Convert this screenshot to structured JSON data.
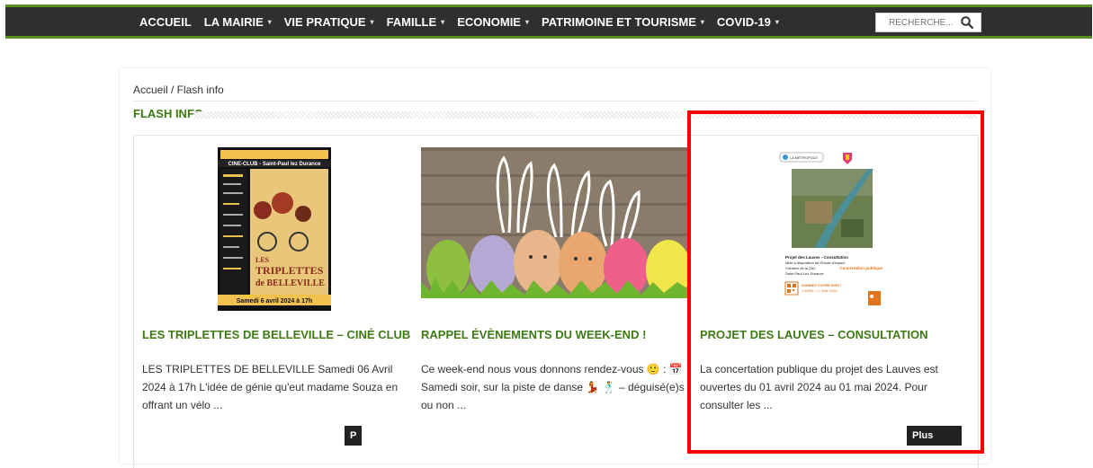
{
  "nav": {
    "items": [
      {
        "label": "ACCUEIL",
        "has_caret": false
      },
      {
        "label": "LA MAIRIE",
        "has_caret": true
      },
      {
        "label": "VIE PRATIQUE",
        "has_caret": true
      },
      {
        "label": "FAMILLE",
        "has_caret": true
      },
      {
        "label": "ECONOMIE",
        "has_caret": true
      },
      {
        "label": "PATRIMOINE ET TOURISME",
        "has_caret": true
      },
      {
        "label": "COVID-19",
        "has_caret": true
      }
    ],
    "caret_glyph": "▾"
  },
  "search": {
    "placeholder": "RECHERCHE..."
  },
  "breadcrumb": "Accueil / Flash info",
  "section_title": "FLASH INFO",
  "posts": [
    {
      "title": "LES TRIPLETTES DE BELLEVILLE – CINÉ CLUB",
      "excerpt": "LES TRIPLETTES DE BELLEVILLE Samedi 06 Avril 2024 à 17h L'idée de génie qu'eut madame Souza en offrant un vélo ...",
      "more": "P",
      "poster": {
        "header": "CINE-CLUB - Saint-Paul lez Durance",
        "line1": "LES",
        "line2": "TRIPLETTES",
        "line3": "de BELLEVILLE",
        "date": "Samedi 6 avril 2024 à 17h"
      }
    },
    {
      "title": "RAPPEL ÉVÈNEMENTS DU WEEK-END !",
      "excerpt": "Ce week-end nous vous donnons rendez-vous 🙂 : 📅 Samedi soir, sur la piste de danse 💃 🕺 – déguisé(e)s ou non ...",
      "more": ""
    },
    {
      "title": "PROJET DES LAUVES – CONSULTATION",
      "excerpt": "La concertation publique du projet des Lauves est ouvertes du 01 avril 2024 au 01 mai 2024. Pour consulter les ...",
      "more": "Plus d'info",
      "doc": {
        "logo": "LA MÉTROPOLE",
        "heading": "Projet des Lauves - Consultation",
        "lines": [
          "Mise à disposition de l'Etude d'impact",
          "Création de la ZAC",
          "Saint-Paul-Lez-Durance"
        ],
        "tag": "Concertation publique",
        "cta": "DONNEZ VOTRE AVIS !",
        "dates": "1 AVRIL > 1 MAI 2024"
      }
    }
  ],
  "colors": {
    "accent_green": "#3d7a14",
    "highlight": "#ff0000",
    "nav_bg": "#2f2f2f"
  }
}
